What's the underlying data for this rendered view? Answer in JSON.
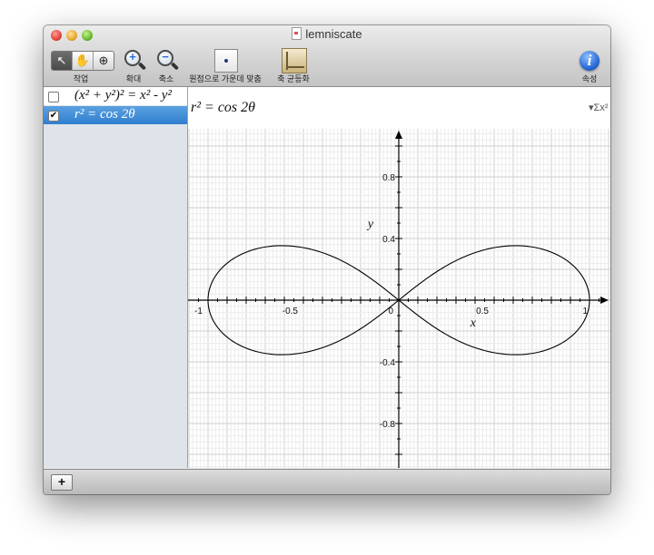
{
  "window": {
    "title": "lemniscate"
  },
  "toolbar": {
    "tools": [
      {
        "glyph": "↖",
        "name": "pointer-icon"
      },
      {
        "glyph": "✋",
        "name": "hand-icon"
      },
      {
        "glyph": "⊕",
        "name": "zoom-tool-icon"
      }
    ],
    "tools_label": "작업",
    "zoom_in": {
      "label": "확대",
      "sign": "+"
    },
    "zoom_out": {
      "label": "축소",
      "sign": "−"
    },
    "center_label": "원점으로 가운데 맞춤",
    "equalize_label": "축 균등화",
    "info": {
      "label": "속성",
      "glyph": "i"
    }
  },
  "equations": [
    {
      "checked": false,
      "check_glyph": "",
      "text": "(x² + y²)² = x² - y²"
    },
    {
      "checked": true,
      "check_glyph": "✔",
      "text": "r² = cos 2θ"
    }
  ],
  "equation_bar": {
    "text": "r² = cos 2θ",
    "options": "▾Σx²"
  },
  "bottom": {
    "add_label": "+"
  },
  "chart_data": {
    "type": "line",
    "x_tick_labels": [
      "-1",
      "-0.5",
      "0",
      "0.5",
      "1"
    ],
    "y_tick_labels": [
      "0.8",
      "0.4",
      "-0.4",
      "-0.8"
    ],
    "xlabel": "x",
    "ylabel": "y",
    "xlim": [
      -1.05,
      1.05
    ],
    "ylim": [
      -1.1,
      1.1
    ],
    "grid": true,
    "series": [
      {
        "name": "r² = cos 2θ",
        "equation": "r^2 = cos(2θ)",
        "color": "#000000"
      }
    ]
  }
}
